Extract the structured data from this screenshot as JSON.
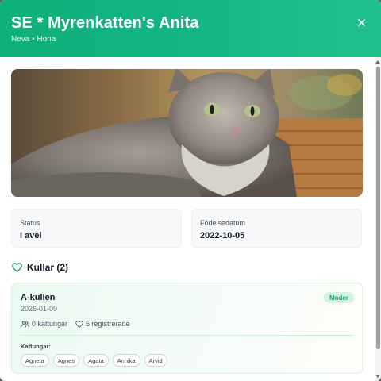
{
  "header": {
    "title": "SE * Myrenkatten's Anita",
    "subtitle": "Neva • Hona",
    "close_icon": "close-icon"
  },
  "photo": {
    "subject": "long-haired grey tabby cat on wicker basket"
  },
  "info_cards": [
    {
      "label": "Status",
      "value": "I avel"
    },
    {
      "label": "Födelsedatum",
      "value": "2022-10-05"
    }
  ],
  "litters_section": {
    "title": "Kullar (2)",
    "icon": "heart-icon"
  },
  "litter": {
    "name": "A-kullen",
    "date": "2026-01-09",
    "role_badge": "Moder",
    "kittens_count": "0 kattungar",
    "registered": "5 registrerade",
    "kittens_label": "Kattungar:",
    "kittens": [
      "Agneta",
      "Agnes",
      "Agata",
      "Annika",
      "Arvid"
    ]
  },
  "colors": {
    "accent": "#13b585",
    "badge_bg": "#d3f3e2",
    "badge_text": "#16a068"
  }
}
